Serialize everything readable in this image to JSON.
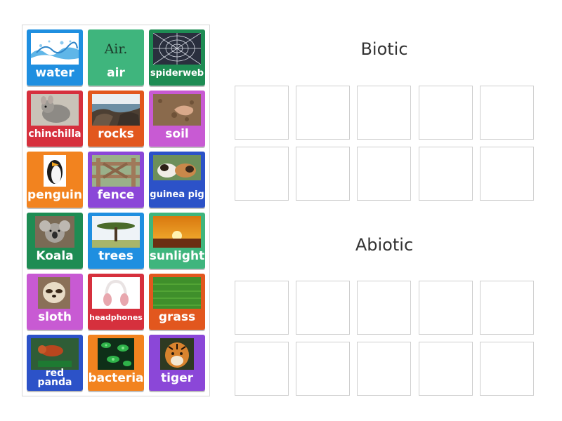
{
  "cards": [
    {
      "label": "water",
      "icon": "water-splash-icon"
    },
    {
      "label": "air",
      "icon": "air-text-icon",
      "picture_text": "Air."
    },
    {
      "label": "spiderweb",
      "icon": "spiderweb-icon"
    },
    {
      "label": "chinchilla",
      "icon": "chinchilla-icon"
    },
    {
      "label": "rocks",
      "icon": "rocks-icon"
    },
    {
      "label": "soil",
      "icon": "soil-icon"
    },
    {
      "label": "penguin",
      "icon": "penguin-icon"
    },
    {
      "label": "fence",
      "icon": "fence-icon"
    },
    {
      "label": "guinea pig",
      "icon": "guinea-pig-icon"
    },
    {
      "label": "Koala",
      "icon": "koala-icon"
    },
    {
      "label": "trees",
      "icon": "tree-icon"
    },
    {
      "label": "sunlight",
      "icon": "sunset-icon"
    },
    {
      "label": "sloth",
      "icon": "sloth-icon"
    },
    {
      "label": "headphones",
      "icon": "headphones-icon"
    },
    {
      "label": "grass",
      "icon": "grass-icon"
    },
    {
      "label": "red panda",
      "icon": "red-panda-icon"
    },
    {
      "label": "bacteria",
      "icon": "bacteria-icon"
    },
    {
      "label": "tiger",
      "icon": "tiger-icon"
    }
  ],
  "groups": {
    "biotic": {
      "title": "Biotic",
      "slot_count": 10
    },
    "abiotic": {
      "title": "Abiotic",
      "slot_count": 10
    }
  },
  "colors": {
    "blue": "#1f8fe0",
    "teal": "#3fb57d",
    "dark_green": "#1e8c53",
    "red": "#d6303d",
    "orange": "#f2831f",
    "magenta": "#c85ad3",
    "purple": "#8b47d8",
    "navy": "#2c52c8"
  }
}
